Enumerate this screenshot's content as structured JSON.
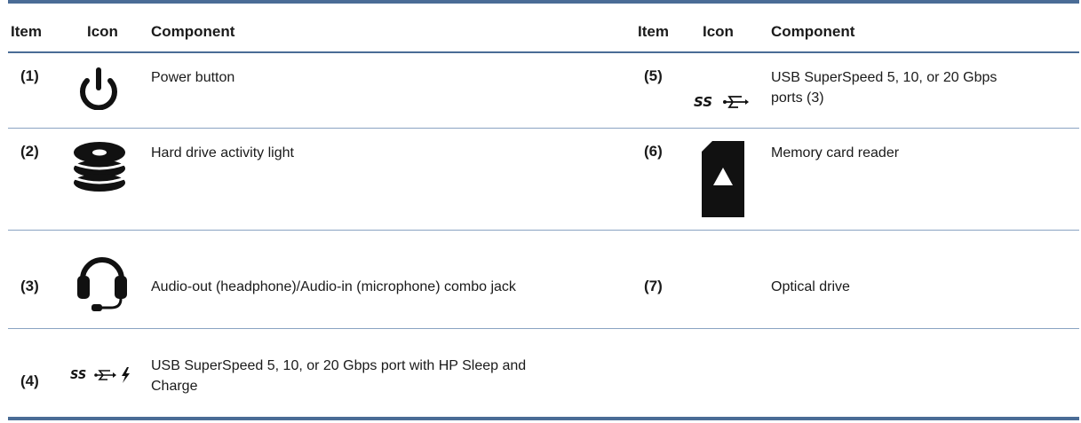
{
  "headers": {
    "item_left": "Item",
    "icon_left": "Icon",
    "component_left": "Component",
    "item_right": "Item",
    "icon_right": "Icon",
    "component_right": "Component"
  },
  "rows": [
    {
      "item": "(1)",
      "icon": "power-icon",
      "component": "Power button"
    },
    {
      "item": "(2)",
      "icon": "hard-drive-icon",
      "component": "Hard drive activity light"
    },
    {
      "item": "(3)",
      "icon": "headset-icon",
      "component": "Audio-out (headphone)/Audio-in (microphone) combo jack"
    },
    {
      "item": "(4)",
      "icon": "usb-ss-charge-icon",
      "component_line1": "USB SuperSpeed 5, 10, or 20 Gbps port with HP Sleep and",
      "component_line2": "Charge"
    },
    {
      "item": "(5)",
      "icon": "usb-ss-icon",
      "component_line1": "USB SuperSpeed 5, 10, or 20 Gbps",
      "component_line2": "ports (3)"
    },
    {
      "item": "(6)",
      "icon": "memory-card-icon",
      "component": "Memory card reader"
    },
    {
      "item": "(7)",
      "icon": "",
      "component": "Optical drive"
    }
  ],
  "icon_text": {
    "ss": "SS"
  },
  "colors": {
    "rule": "#4a6c96",
    "thin_rule": "#8aa3c2",
    "icon": "#111111"
  }
}
